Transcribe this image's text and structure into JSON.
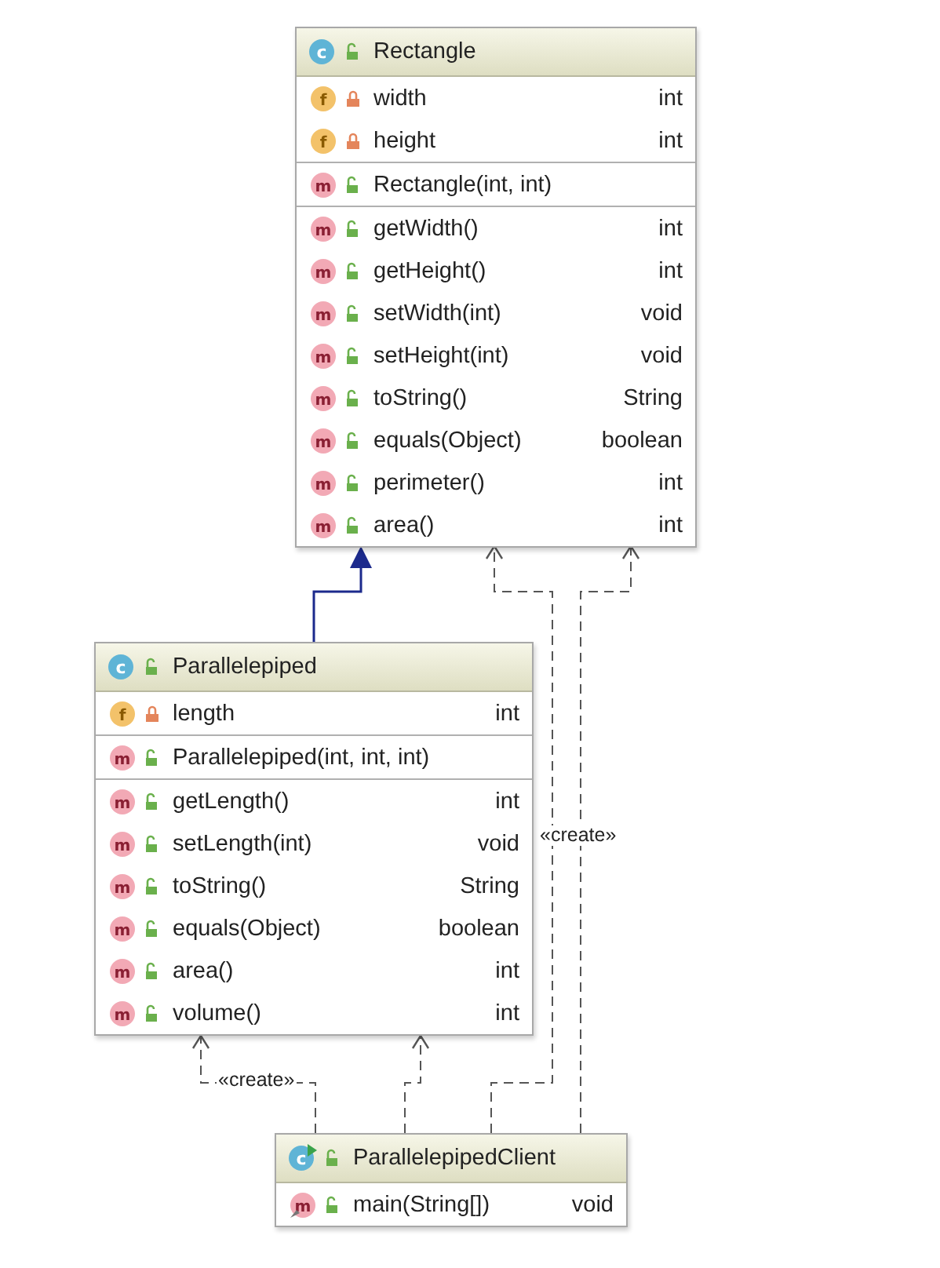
{
  "classes": [
    {
      "name": "Rectangle",
      "badge": "c",
      "private": false,
      "runnable": false,
      "sections": [
        [
          {
            "kind": "field",
            "badge": "f",
            "private": true,
            "static": false,
            "name": "width",
            "type": "int"
          },
          {
            "kind": "field",
            "badge": "f",
            "private": true,
            "static": false,
            "name": "height",
            "type": "int"
          }
        ],
        [
          {
            "kind": "method",
            "badge": "m",
            "private": false,
            "static": false,
            "name": "Rectangle(int, int)"
          }
        ],
        [
          {
            "kind": "method",
            "badge": "m",
            "private": false,
            "static": false,
            "name": "getWidth()",
            "type": "int"
          },
          {
            "kind": "method",
            "badge": "m",
            "private": false,
            "static": false,
            "name": "getHeight()",
            "type": "int"
          },
          {
            "kind": "method",
            "badge": "m",
            "private": false,
            "static": false,
            "name": "setWidth(int)",
            "type": "void"
          },
          {
            "kind": "method",
            "badge": "m",
            "private": false,
            "static": false,
            "name": "setHeight(int)",
            "type": "void"
          },
          {
            "kind": "method",
            "badge": "m",
            "private": false,
            "static": false,
            "name": "toString()",
            "type": "String"
          },
          {
            "kind": "method",
            "badge": "m",
            "private": false,
            "static": false,
            "name": "equals(Object)",
            "type": "boolean"
          },
          {
            "kind": "method",
            "badge": "m",
            "private": false,
            "static": false,
            "name": "perimeter()",
            "type": "int"
          },
          {
            "kind": "method",
            "badge": "m",
            "private": false,
            "static": false,
            "name": "area()",
            "type": "int"
          }
        ]
      ]
    },
    {
      "name": "Parallelepiped",
      "badge": "c",
      "private": false,
      "runnable": false,
      "sections": [
        [
          {
            "kind": "field",
            "badge": "f",
            "private": true,
            "static": false,
            "name": "length",
            "type": "int"
          }
        ],
        [
          {
            "kind": "method",
            "badge": "m",
            "private": false,
            "static": false,
            "name": "Parallelepiped(int, int, int)"
          }
        ],
        [
          {
            "kind": "method",
            "badge": "m",
            "private": false,
            "static": false,
            "name": "getLength()",
            "type": "int"
          },
          {
            "kind": "method",
            "badge": "m",
            "private": false,
            "static": false,
            "name": "setLength(int)",
            "type": "void"
          },
          {
            "kind": "method",
            "badge": "m",
            "private": false,
            "static": false,
            "name": "toString()",
            "type": "String"
          },
          {
            "kind": "method",
            "badge": "m",
            "private": false,
            "static": false,
            "name": "equals(Object)",
            "type": "boolean"
          },
          {
            "kind": "method",
            "badge": "m",
            "private": false,
            "static": false,
            "name": "area()",
            "type": "int"
          },
          {
            "kind": "method",
            "badge": "m",
            "private": false,
            "static": false,
            "name": "volume()",
            "type": "int"
          }
        ]
      ]
    },
    {
      "name": "ParallelepipedClient",
      "badge": "c",
      "private": false,
      "runnable": true,
      "sections": [
        [
          {
            "kind": "method",
            "badge": "m",
            "private": false,
            "static": true,
            "name": "main(String[])",
            "type": "void"
          }
        ]
      ]
    }
  ],
  "relations": [
    {
      "kind": "extends"
    },
    {
      "kind": "create",
      "label": "«create»"
    },
    {
      "kind": "dependency"
    },
    {
      "kind": "create",
      "label": "«create»"
    },
    {
      "kind": "dependency"
    }
  ]
}
